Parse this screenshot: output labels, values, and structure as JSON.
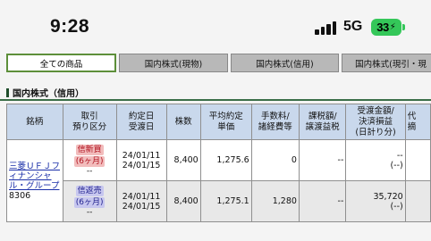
{
  "status": {
    "time": "9:28",
    "network": "5G",
    "battery": "33"
  },
  "tabs": [
    "全ての商品",
    "国内株式(現物)",
    "国内株式(信用)",
    "国内株式(現引・現"
  ],
  "section_title": "国内株式（信用）",
  "table": {
    "headers": {
      "name": "銘柄",
      "trade": [
        "取引",
        "預り区分"
      ],
      "dates": [
        "約定日",
        "受渡日"
      ],
      "shares": "株数",
      "avg": [
        "平均約定",
        "単価"
      ],
      "fee": [
        "手数料/",
        "諸経費等"
      ],
      "tax": [
        "課税額/",
        "譲渡益税"
      ],
      "settle": [
        "受渡金額/",
        "決済損益",
        "(日計り分)"
      ],
      "extra": [
        "代",
        "摘"
      ]
    },
    "stock": {
      "name": "三菱ＵＦＪフィナンシャル・グループ",
      "code": "8306"
    },
    "rows": [
      {
        "trade_type": "信新買",
        "term": "(6ヶ月)",
        "sub": "--",
        "trade_date": "24/01/11",
        "delivery_date": "24/01/15",
        "shares": "8,400",
        "avg_price": "1,275.6",
        "fee": "0",
        "tax": "--",
        "settle_top": "--",
        "settle_bottom": "(--)"
      },
      {
        "trade_type": "信返売",
        "term": "(6ヶ月)",
        "sub": "--",
        "trade_date": "24/01/11",
        "delivery_date": "24/01/15",
        "shares": "8,400",
        "avg_price": "1,275.1",
        "fee": "1,280",
        "tax": "--",
        "settle_top": "35,720",
        "settle_bottom": "(--)"
      }
    ]
  }
}
